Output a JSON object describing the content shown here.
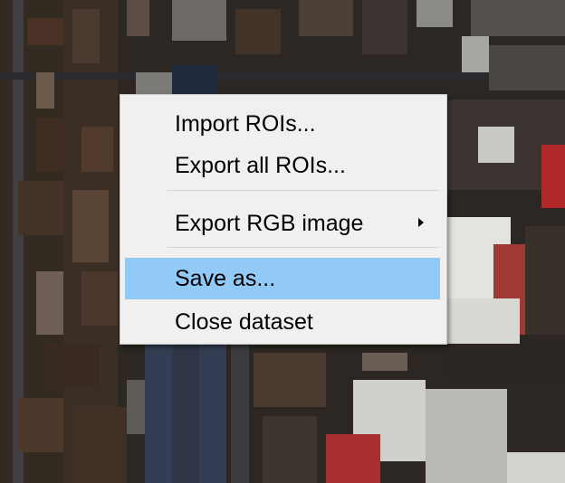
{
  "context_menu": {
    "items": [
      {
        "label": "Import ROIs..."
      },
      {
        "label": "Export all ROIs..."
      },
      {
        "label": "Export RGB image",
        "has_submenu": true
      },
      {
        "label": "Save as...",
        "selected": true
      },
      {
        "label": "Close dataset"
      }
    ],
    "highlight_color": "#91c9f7",
    "background_color": "#f0f0f0"
  },
  "background": {
    "image": "aerial-rgb-view",
    "icon": "aerial-map"
  }
}
